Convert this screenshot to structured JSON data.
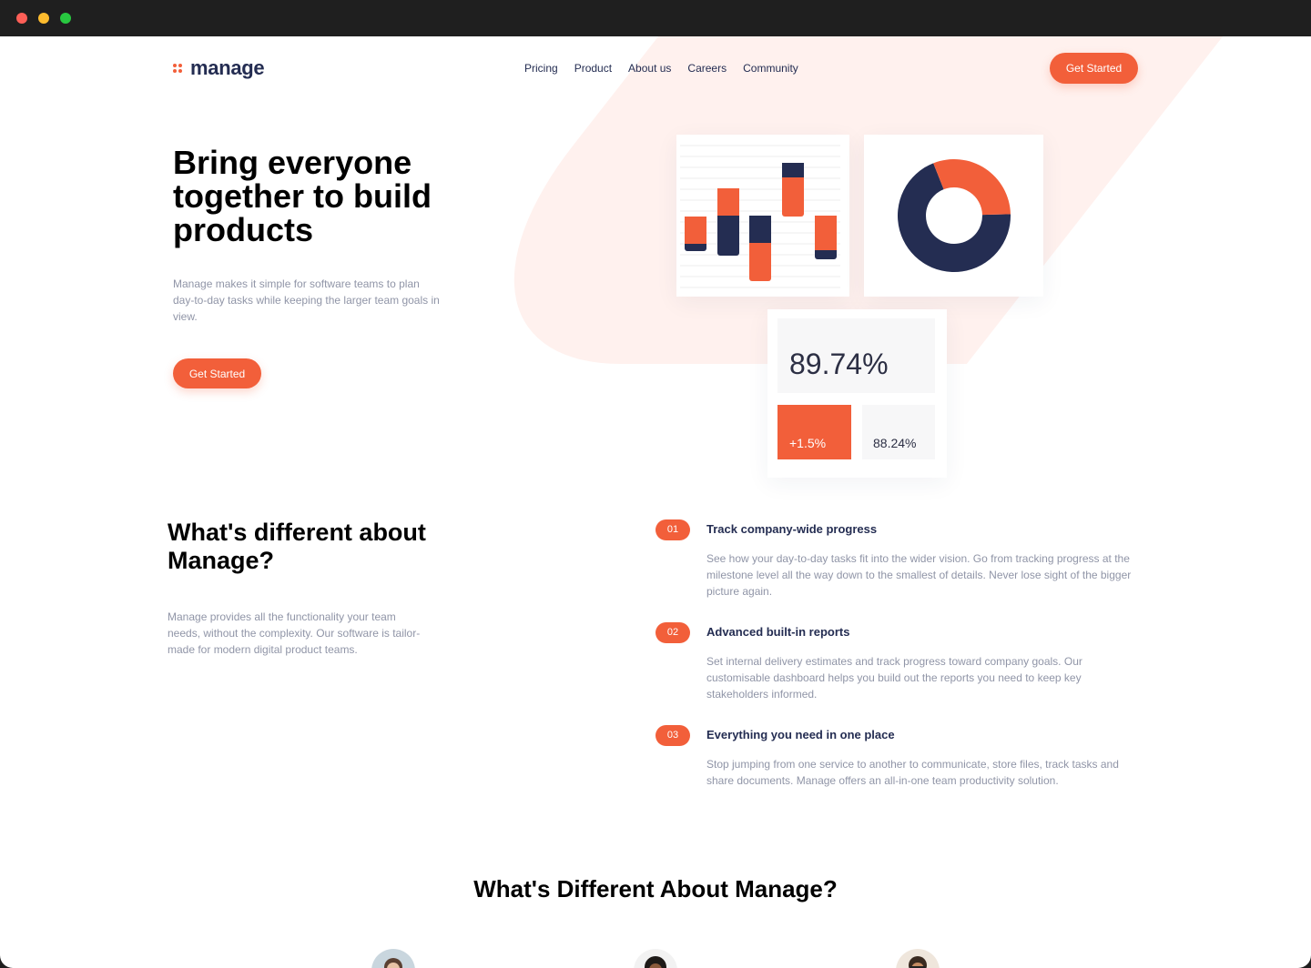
{
  "brand": {
    "name": "manage",
    "accent": "#f25f3a",
    "navy": "#242d52"
  },
  "nav": {
    "items": [
      "Pricing",
      "Product",
      "About us",
      "Careers",
      "Community"
    ]
  },
  "header": {
    "cta_label": "Get Started"
  },
  "hero": {
    "title": "Bring everyone together to build products",
    "description": "Manage makes it simple for software teams to plan day-to-day tasks while keeping the larger team goals in view.",
    "cta_label": "Get Started"
  },
  "stats": {
    "main": "89.74%",
    "change": "+1.5%",
    "secondary": "88.24%"
  },
  "donut": {
    "orange_fraction": 0.25
  },
  "features": {
    "title": "What's different about Manage?",
    "description": "Manage provides all the functionality your team needs, without the complexity. Our software is tailor-made for modern digital product teams.",
    "items": [
      {
        "number": "01",
        "title": "Track company-wide progress",
        "text": "See how your day-to-day tasks fit into the wider vision. Go from tracking progress at the milestone level all the way down to the smallest of details. Never lose sight of the bigger picture again."
      },
      {
        "number": "02",
        "title": "Advanced built-in reports",
        "text": "Set internal delivery estimates and track progress toward company goals. Our customisable dashboard helps you build out the reports you need to keep key stakeholders informed."
      },
      {
        "number": "03",
        "title": "Everything you need in one place",
        "text": "Stop jumping from one service to another to communicate, store files, track tasks and share documents. Manage offers an all-in-one team productivity solution."
      }
    ]
  },
  "testimonials": {
    "title": "What's Different About Manage?"
  }
}
